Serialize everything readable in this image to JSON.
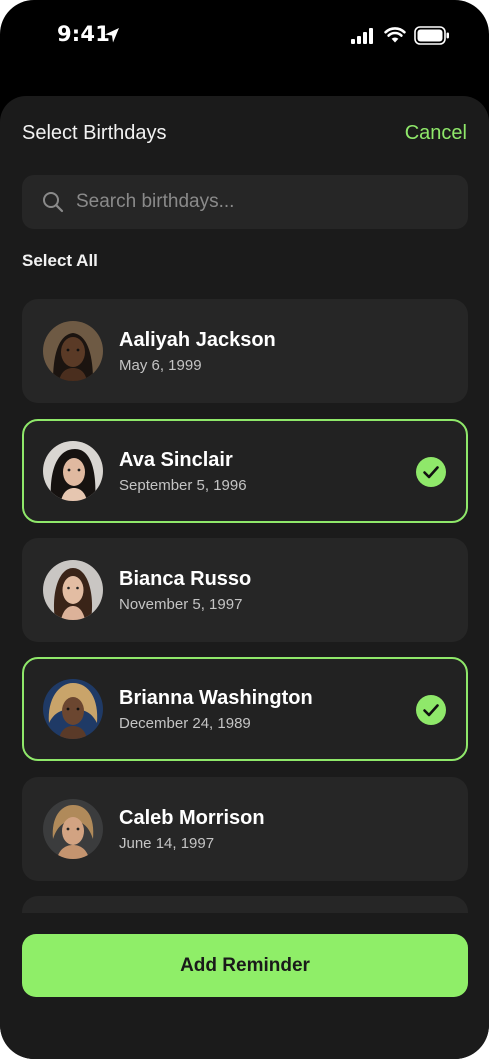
{
  "status_bar": {
    "time": "9:41"
  },
  "sheet": {
    "title": "Select Birthdays",
    "cancel_label": "Cancel",
    "search": {
      "placeholder": "Search birthdays..."
    },
    "select_all_label": "Select All"
  },
  "birthdays": [
    {
      "name": "Aaliyah Jackson",
      "date": "May 6, 1999",
      "selected": false
    },
    {
      "name": "Ava Sinclair",
      "date": "September 5, 1996",
      "selected": true
    },
    {
      "name": "Bianca Russo",
      "date": "November 5, 1997",
      "selected": false
    },
    {
      "name": "Brianna Washington",
      "date": "December 24, 1989",
      "selected": true
    },
    {
      "name": "Caleb Morrison",
      "date": "June 14, 1997",
      "selected": false
    }
  ],
  "add_button_label": "Add Reminder",
  "colors": {
    "accent": "#8fe86a",
    "sheet_bg": "#1b1b1b",
    "card_bg": "#262626",
    "button_bg": "#8fee68"
  }
}
